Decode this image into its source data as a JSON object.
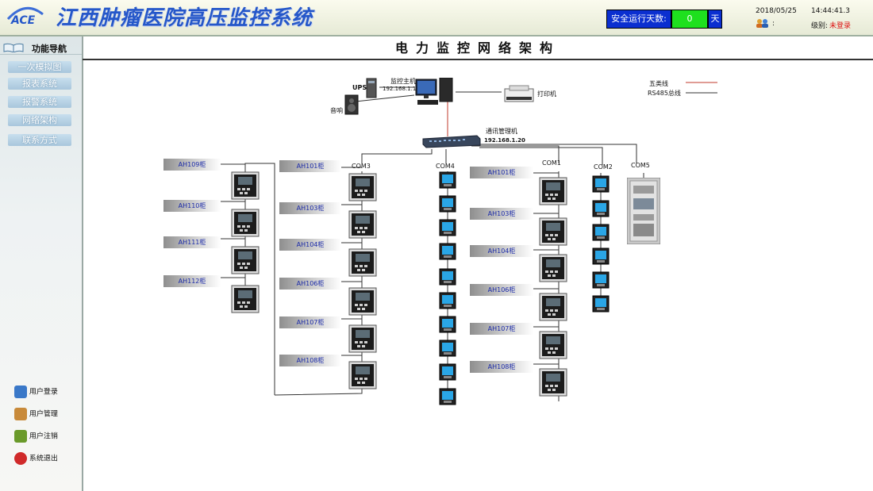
{
  "header": {
    "logo_text": "ACE",
    "title": "江西肿瘤医院高压监控系统",
    "safety_label": "安全运行天数:",
    "safety_days": "0",
    "safety_unit": "天",
    "date": "2018/05/25",
    "time": "14:44:41.3",
    "user_sep": ":",
    "level_label": "级别:",
    "level_value": "未登录"
  },
  "sidebar": {
    "title": "功能导航",
    "items": [
      "一次模拟图",
      "报表系统",
      "报警系统",
      "网络架构",
      "联系方式"
    ],
    "links": [
      {
        "label": "用户登录",
        "icon": "user-login-icon"
      },
      {
        "label": "用户管理",
        "icon": "user-manage-icon"
      },
      {
        "label": "用户注销",
        "icon": "key-icon"
      },
      {
        "label": "系统退出",
        "icon": "power-icon"
      }
    ]
  },
  "page_title": "电力监控网络架构",
  "diagram": {
    "ups": "UPS",
    "host_label": "监控主机",
    "host_ip": "192.168.1.10",
    "printer": "打印机",
    "speaker": "音响",
    "switch_label": "通讯管理机",
    "switch_ip": "192.168.1.20",
    "legend_cat5": "五类线",
    "legend_rs485": "RS485总线",
    "ports": [
      "COM3",
      "COM4",
      "COM1",
      "COM2",
      "COM5"
    ],
    "col_a": [
      "AH109柜",
      "AH110柜",
      "AH111柜",
      "AH112柜"
    ],
    "col_b": [
      "AH101柜",
      "AH103柜",
      "AH104柜",
      "AH106柜",
      "AH107柜",
      "AH108柜"
    ],
    "col_c": [
      "AH101柜",
      "AH103柜",
      "AH104柜",
      "AH106柜",
      "AH107柜",
      "AH108柜"
    ],
    "colors": {
      "cat5": "#c0392b",
      "rs485": "#333333",
      "label_text": "#1b2aa8"
    }
  }
}
